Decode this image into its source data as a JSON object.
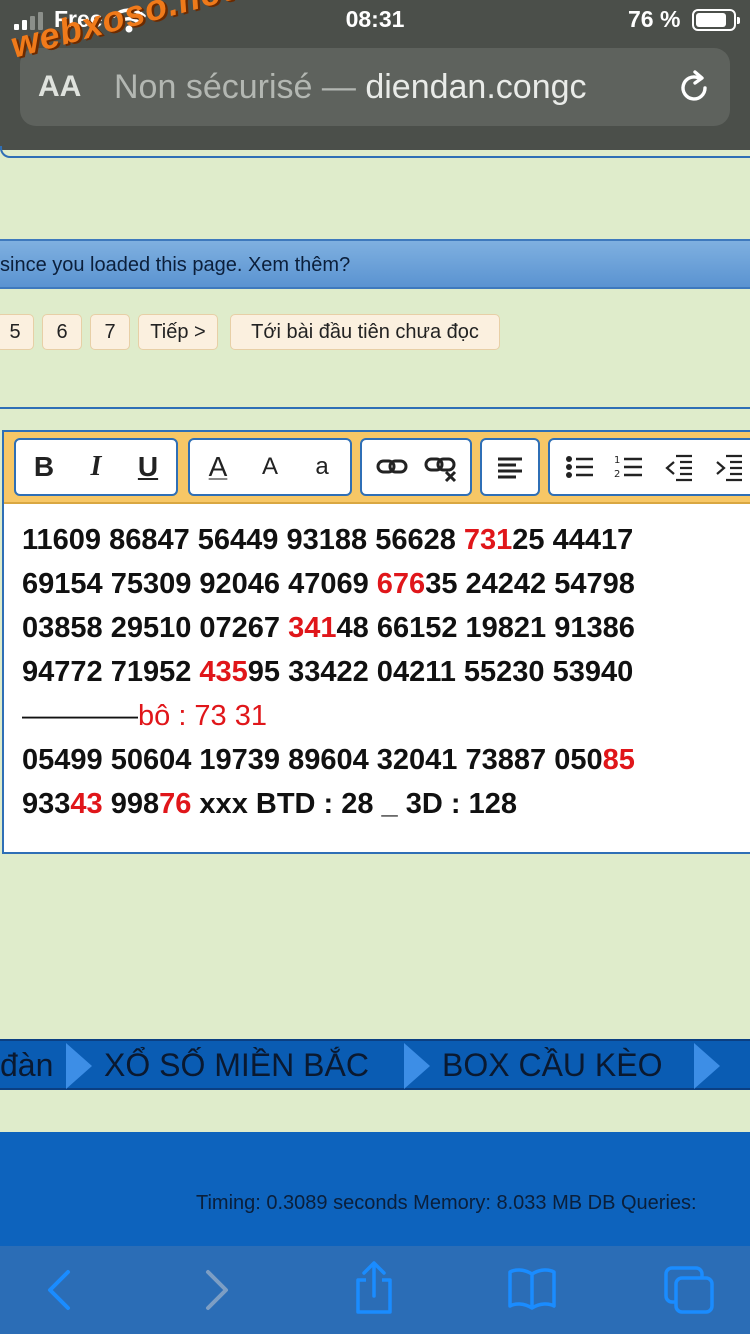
{
  "status_bar": {
    "carrier": "Free",
    "time": "08:31",
    "battery": "76 %"
  },
  "browser": {
    "reader_button": "AA",
    "security": "Non sécurisé —",
    "domain": "diendan.congc",
    "watermark": "webxoso.net"
  },
  "notice": {
    "text": "since you loaded this page. Xem thêm?"
  },
  "pagination": {
    "pages": [
      "5",
      "6",
      "7"
    ],
    "next": "Tiếp >",
    "first_unread": "Tới bài đầu tiên chưa đọc"
  },
  "toolbar": {
    "bold": "B",
    "italic": "I",
    "underline": "U",
    "font_color": "A",
    "font_size": "A",
    "font_style": "a"
  },
  "post": {
    "line1": {
      "a": "11609 86847 56449 93188 56628 ",
      "hl": "731",
      "b": "25 44417"
    },
    "line2": {
      "a": "69154 75309 92046 47069 ",
      "hl": "676",
      "b": "35 24242 54798"
    },
    "line3": {
      "a": "03858 29510 07267 ",
      "hl": "341",
      "b": "48 66152 19821 91386"
    },
    "line4": {
      "a": "94772 71952 ",
      "hl": "435",
      "b": "95 33422 04211 55230 53940"
    },
    "line5": {
      "dash": " ————",
      "text": "bô : 73 31"
    },
    "line6": {
      "a": "05499 50604 19739 89604 32041 73887 050",
      "hl": "85"
    },
    "line7": {
      "a": "933",
      "hl1": "43",
      "b": " 998",
      "hl2": "76",
      "c": " xxx BTD : 28 _ 3D : 128"
    }
  },
  "breadcrumb": {
    "item1": "đàn",
    "item2": "XỔ SỐ MIỀN BẮC",
    "item3": "BOX CẦU KÈO"
  },
  "footer": {
    "stats": "Timing: 0.3089 seconds Memory: 8.033 MB DB Queries:"
  },
  "colors": {
    "highlight": "#e0161a",
    "page_bg": "#dfeccb",
    "nav_blue": "#0a5cb3",
    "toolbar_bg": "#f7c766"
  }
}
